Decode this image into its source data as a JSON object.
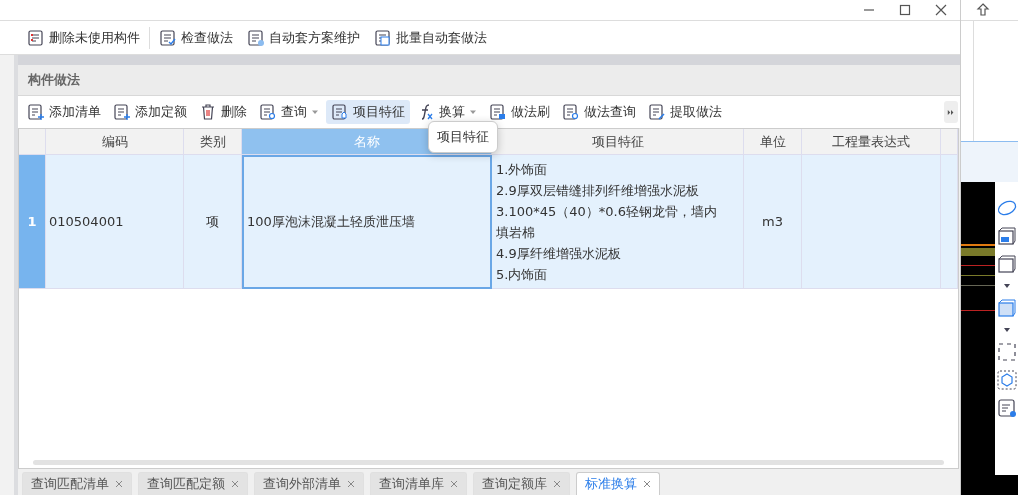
{
  "toolbar": [
    {
      "label": "删除未使用构件"
    },
    {
      "label": "检查做法"
    },
    {
      "label": "自动套方案维护"
    },
    {
      "label": "批量自动套做法"
    }
  ],
  "panel": {
    "title": "构件做法",
    "actions": [
      {
        "label": "添加清单",
        "dropdown": false,
        "selected": false
      },
      {
        "label": "添加定额",
        "dropdown": false,
        "selected": false
      },
      {
        "label": "删除",
        "dropdown": false,
        "selected": false
      },
      {
        "label": "查询",
        "dropdown": true,
        "selected": false
      },
      {
        "label": "项目特征",
        "dropdown": false,
        "selected": true
      },
      {
        "label": "换算",
        "dropdown": true,
        "selected": false
      },
      {
        "label": "做法刷",
        "dropdown": false,
        "selected": false
      },
      {
        "label": "做法查询",
        "dropdown": false,
        "selected": false
      },
      {
        "label": "提取做法",
        "dropdown": false,
        "selected": false
      }
    ],
    "tooltip": "项目特征",
    "table": {
      "columns": [
        {
          "label": "编码",
          "selected": false
        },
        {
          "label": "类别",
          "selected": false
        },
        {
          "label": "名称",
          "selected": true
        },
        {
          "label": "项目特征",
          "selected": false
        },
        {
          "label": "单位",
          "selected": false
        },
        {
          "label": "工程量表达式",
          "selected": false
        }
      ],
      "rows": [
        {
          "number": "1",
          "selected": true,
          "code": "010504001",
          "category": "项",
          "name": "100厚泡沫混凝土轻质泄压墙",
          "features": [
            "1.外饰面",
            "2.9厚双层错缝排列纤维增强水泥板",
            "3.100*45（40）*0.6轻钢龙骨，墙内填岩棉",
            "4.9厚纤维增强水泥板",
            "5.内饰面"
          ],
          "unit": "m3"
        }
      ]
    }
  },
  "bottom_tabs": [
    {
      "label": "查询匹配清单",
      "selected": false
    },
    {
      "label": "查询匹配定额",
      "selected": false
    },
    {
      "label": "查询外部清单",
      "selected": false
    },
    {
      "label": "查询清单库",
      "selected": false
    },
    {
      "label": "查询定额库",
      "selected": false
    },
    {
      "label": "标准换算",
      "selected": true
    }
  ]
}
